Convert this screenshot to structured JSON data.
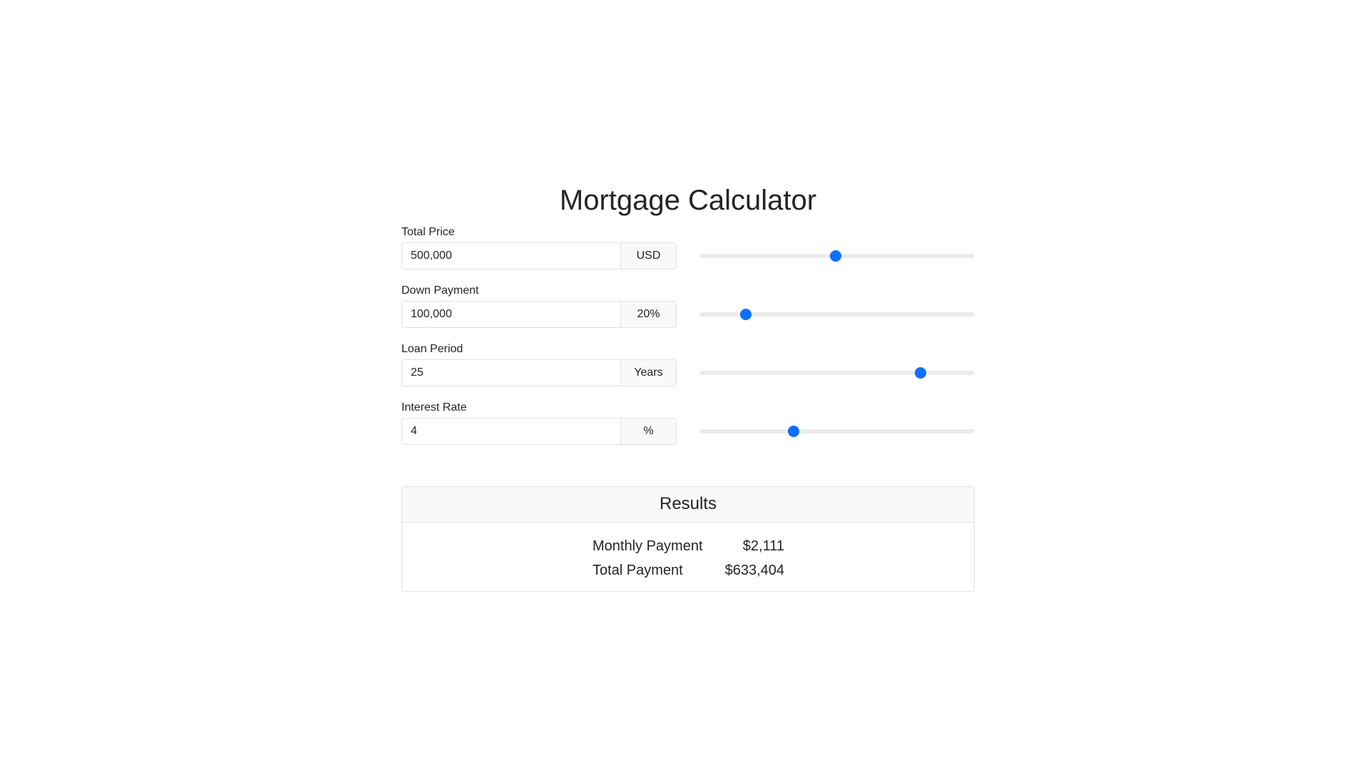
{
  "page": {
    "title": "Mortgage Calculator"
  },
  "fields": [
    {
      "label": "Total Price",
      "value": "500,000",
      "unit": "USD",
      "slider_fraction": 0.495
    },
    {
      "label": "Down Payment",
      "value": "100,000",
      "unit": "20%",
      "slider_fraction": 0.155
    },
    {
      "label": "Loan Period",
      "value": "25",
      "unit": "Years",
      "slider_fraction": 0.815
    },
    {
      "label": "Interest Rate",
      "value": "4",
      "unit": "%",
      "slider_fraction": 0.335
    }
  ],
  "results": {
    "header": "Results",
    "rows": [
      {
        "label": "Monthly Payment",
        "value": "$2,111"
      },
      {
        "label": "Total Payment",
        "value": "$633,404"
      }
    ]
  },
  "colors": {
    "accent": "#0d6efd",
    "track": "#e9ecef",
    "border": "#dee2e6",
    "addon_bg": "#f8f9fa",
    "text": "#212529"
  }
}
